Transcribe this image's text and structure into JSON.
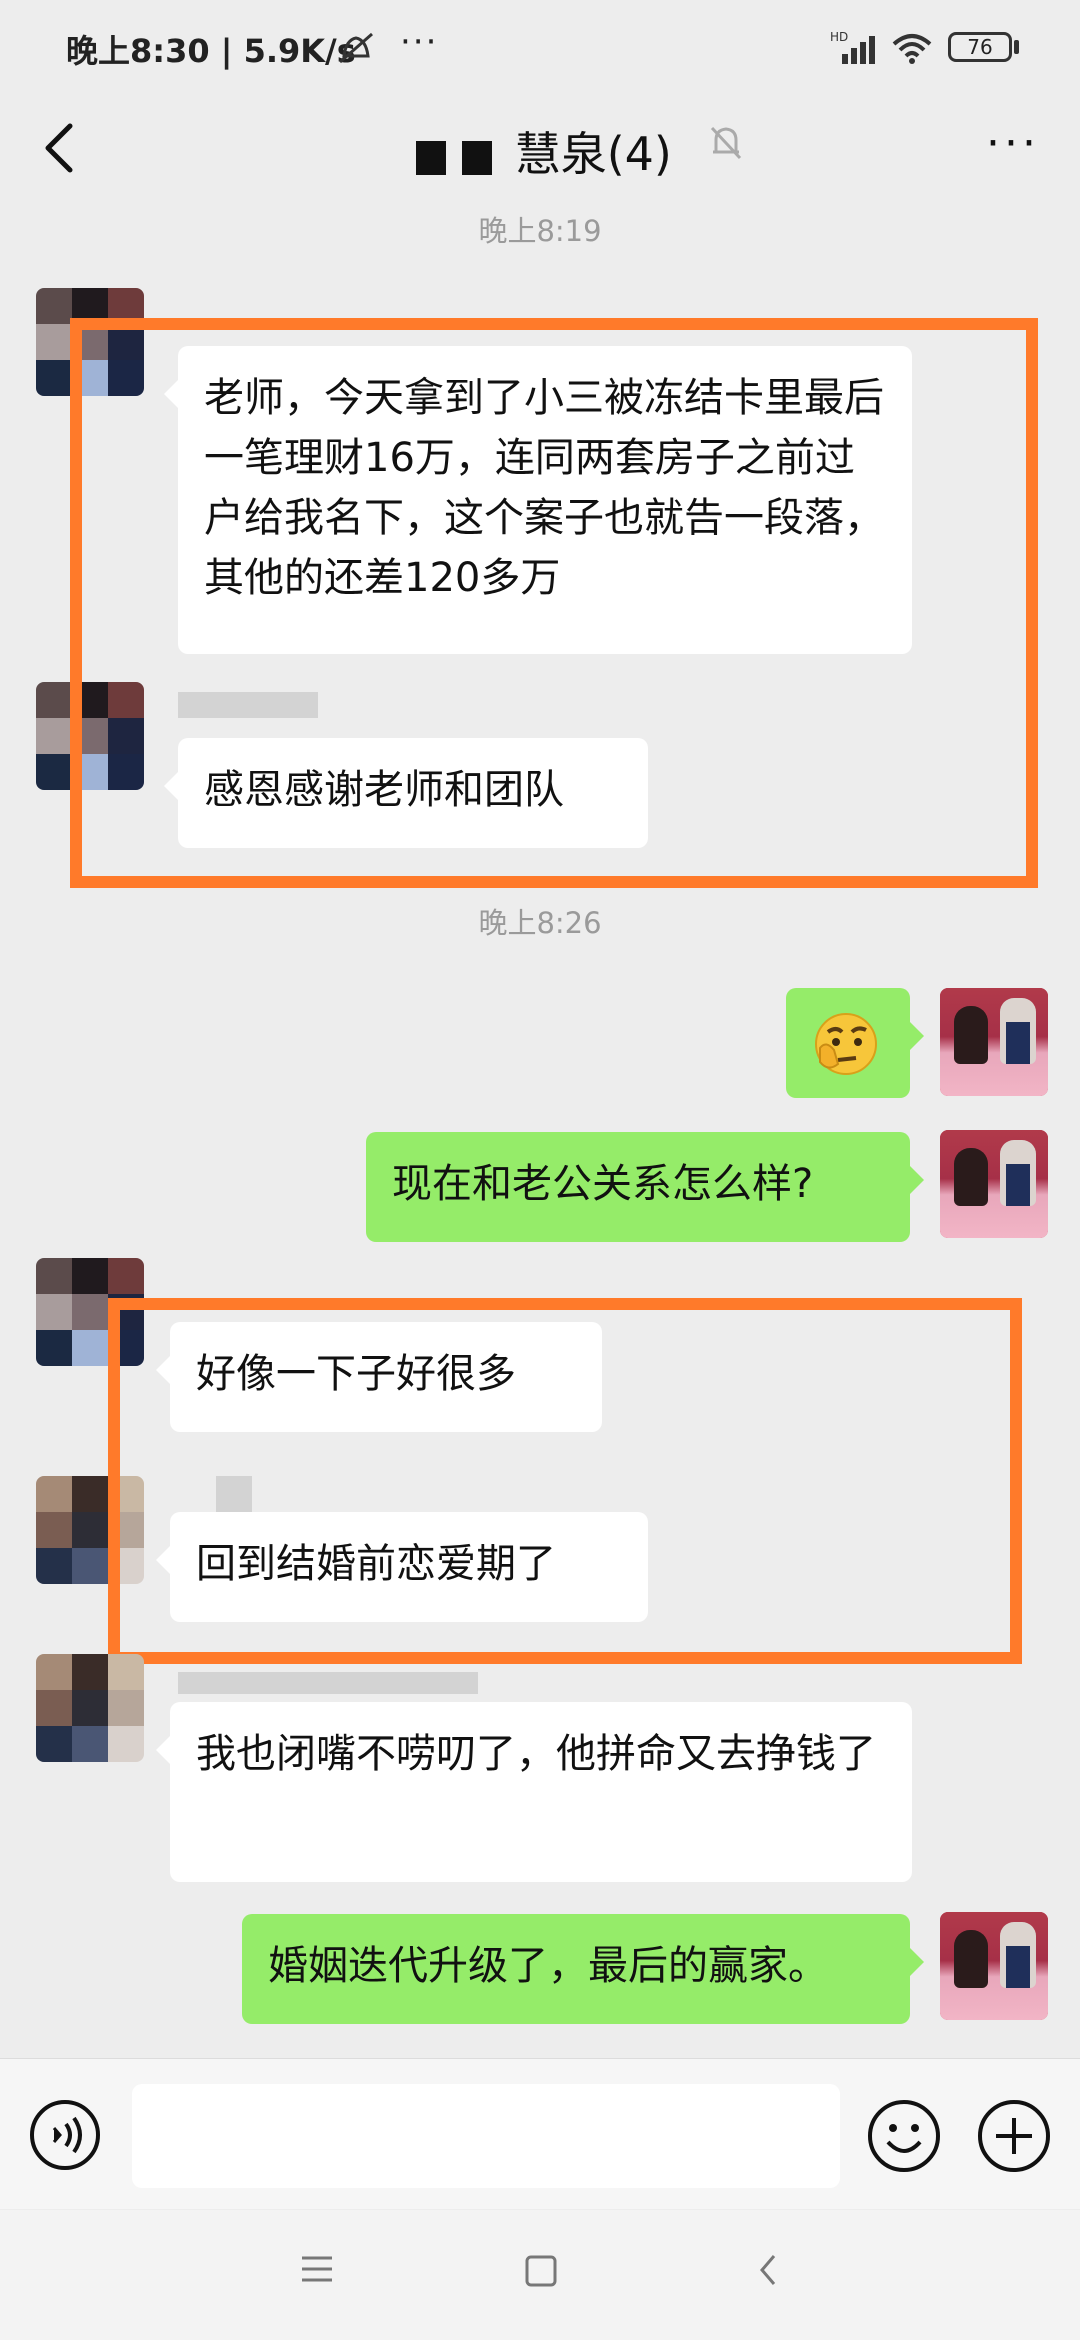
{
  "status_bar": {
    "time": "晚上8:30 | 5.9K/s",
    "more": "···",
    "battery": "76"
  },
  "header": {
    "title": "慧泉(4)",
    "menu": "···"
  },
  "timestamps": [
    "晚上8:19",
    "晚上8:26"
  ],
  "messages": [
    {
      "side": "in",
      "text": "老师，今天拿到了小三被冻结卡里最后一笔理财16万，连同两套房子之前过户给我名下，这个案子也就告一段落，其他的还差120多万"
    },
    {
      "side": "in",
      "text": "感恩感谢老师和团队"
    },
    {
      "side": "out",
      "icon": "thinking-emoji-icon"
    },
    {
      "side": "out",
      "text": "现在和老公关系怎么样?"
    },
    {
      "side": "in",
      "text": "好像一下子好很多"
    },
    {
      "side": "in",
      "text": "回到结婚前恋爱期了"
    },
    {
      "side": "in",
      "text": "我也闭嘴不唠叨了，他拼命又去挣钱了"
    },
    {
      "side": "out",
      "text": "婚姻迭代升级了，最后的赢家。"
    }
  ],
  "colors": {
    "background": "#ededed",
    "bubble_in": "#ffffff",
    "bubble_out": "#95ec69",
    "annotation": "#ff7a2a"
  }
}
